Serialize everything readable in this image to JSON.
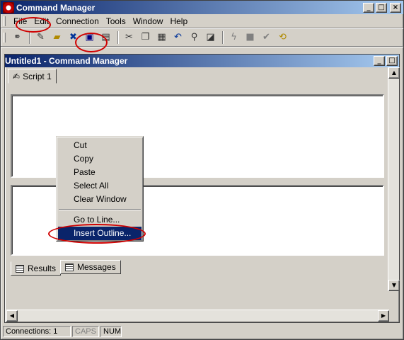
{
  "window": {
    "title": "Command Manager"
  },
  "menu": [
    "File",
    "Edit",
    "Connection",
    "Tools",
    "Window",
    "Help"
  ],
  "toolbar": {
    "icons": [
      "connect-icon",
      "new-script-icon",
      "open-icon",
      "disconnect-icon",
      "save-icon",
      "save-as-icon",
      "cut-icon",
      "copy-icon",
      "paste-icon",
      "undo-icon",
      "find-icon",
      "edit-icon",
      "execute-icon",
      "stop-icon",
      "check-icon",
      "refresh-icon"
    ]
  },
  "child": {
    "title": "Untitled1 - Command Manager",
    "script_tab": "Script 1",
    "results_tab": "Results",
    "messages_tab": "Messages"
  },
  "context_menu": {
    "items": [
      "Cut",
      "Copy",
      "Paste",
      "Select All",
      "Clear Window",
      "Go to Line...",
      "Insert Outline..."
    ],
    "selected": "Insert Outline..."
  },
  "status": {
    "connections": "Connections: 1",
    "caps": "CAPS",
    "num": "NUM"
  },
  "colors": {
    "titlebar": "#0a246a",
    "annotation": "#d00000",
    "face": "#d4d0c8"
  }
}
